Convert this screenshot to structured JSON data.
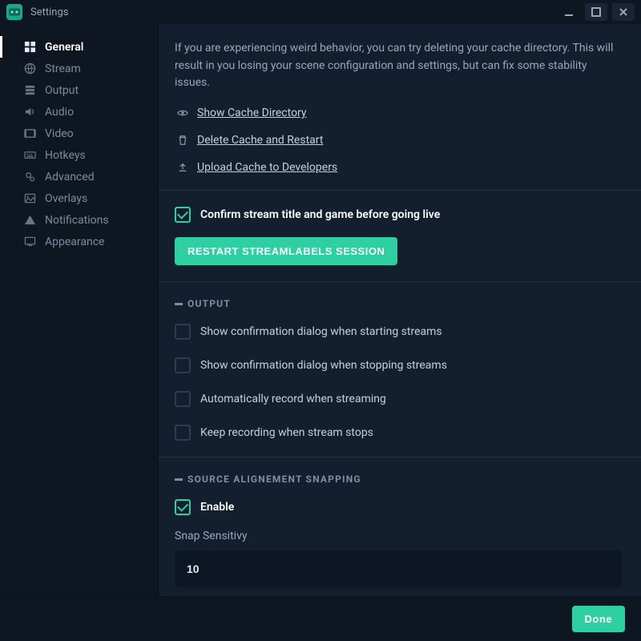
{
  "window": {
    "title": "Settings"
  },
  "sidebar": {
    "items": [
      {
        "label": "General",
        "active": true
      },
      {
        "label": "Stream",
        "active": false
      },
      {
        "label": "Output",
        "active": false
      },
      {
        "label": "Audio",
        "active": false
      },
      {
        "label": "Video",
        "active": false
      },
      {
        "label": "Hotkeys",
        "active": false
      },
      {
        "label": "Advanced",
        "active": false
      },
      {
        "label": "Overlays",
        "active": false
      },
      {
        "label": "Notifications",
        "active": false
      },
      {
        "label": "Appearance",
        "active": false
      }
    ]
  },
  "general": {
    "cache_help": "If you are experiencing weird behavior, you can try deleting your cache directory. This will result in you losing your scene configuration and settings, but can fix some stability issues.",
    "links": {
      "show_cache": "Show Cache Directory",
      "delete_cache": "Delete Cache and Restart",
      "upload_cache": "Upload Cache to Developers"
    },
    "confirm_checkbox": {
      "checked": true,
      "label": "Confirm stream title and game before going live"
    },
    "restart_button": "Restart Streamlabels Session"
  },
  "output_section": {
    "heading": "Output",
    "options": [
      {
        "label": "Show confirmation dialog when starting streams",
        "checked": false
      },
      {
        "label": "Show confirmation dialog when stopping streams",
        "checked": false
      },
      {
        "label": "Automatically record when streaming",
        "checked": false
      },
      {
        "label": "Keep recording when stream stops",
        "checked": false
      }
    ]
  },
  "snapping_section": {
    "heading": "Source Alignement Snapping",
    "enable": {
      "label": "Enable",
      "checked": true
    },
    "sensitivity_label": "Snap Sensitivy",
    "sensitivity_value": "10"
  },
  "footer": {
    "done": "Done"
  }
}
